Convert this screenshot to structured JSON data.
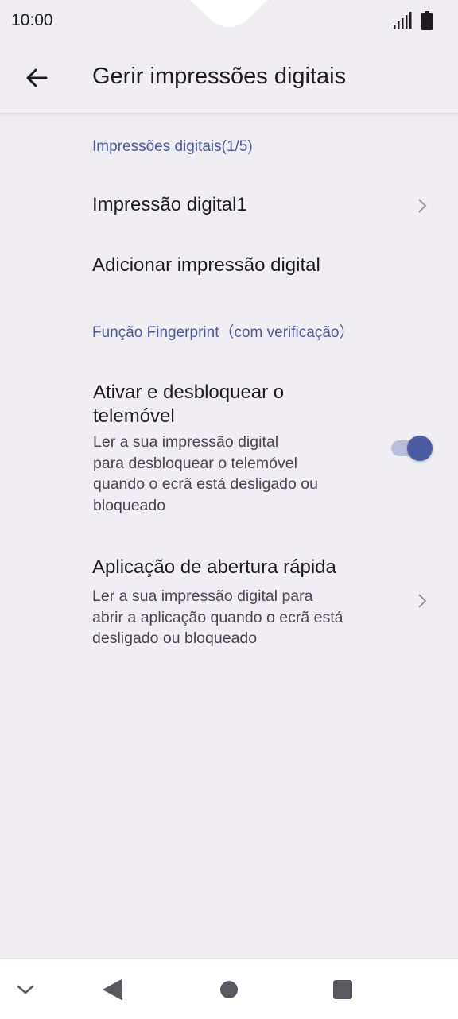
{
  "status_bar": {
    "time": "10:00",
    "icons": [
      "signal-icon",
      "battery-icon"
    ]
  },
  "app_bar": {
    "title": "Gerir impressões digitais",
    "back_icon": "arrow-left-icon"
  },
  "sections": {
    "fingerprints_header": "Impressões digitais(1/5)",
    "fingerprint_item": "Impressão digital1",
    "add_fingerprint": "Adicionar impressão digital",
    "function_header": "Função Fingerprint（com verificação）",
    "unlock": {
      "title_line1": "Ativar e desbloquear o",
      "title_line2": "telemóvel",
      "sub_line1": "Ler a sua impressão digital",
      "sub_line2": "para desbloquear o telemóvel",
      "sub_line3": "quando o ecrã está desligado ou",
      "sub_line4": "bloqueado",
      "enabled": true
    },
    "quick_open": {
      "title": "Aplicação de abertura rápida",
      "sub_line1": "Ler a sua impressão digital para",
      "sub_line2": "abrir a aplicação quando o ecrã está",
      "sub_line3": "desligado ou bloqueado"
    }
  },
  "nav_bar": {
    "icons": [
      "chevron-down-icon",
      "back-triangle-icon",
      "home-circle-icon",
      "recents-square-icon"
    ]
  },
  "colors": {
    "background": "#f0eef2",
    "accent": "#4b5ba4",
    "section_header": "#4a5aa0",
    "toggle_track": "#b9bdd9"
  }
}
